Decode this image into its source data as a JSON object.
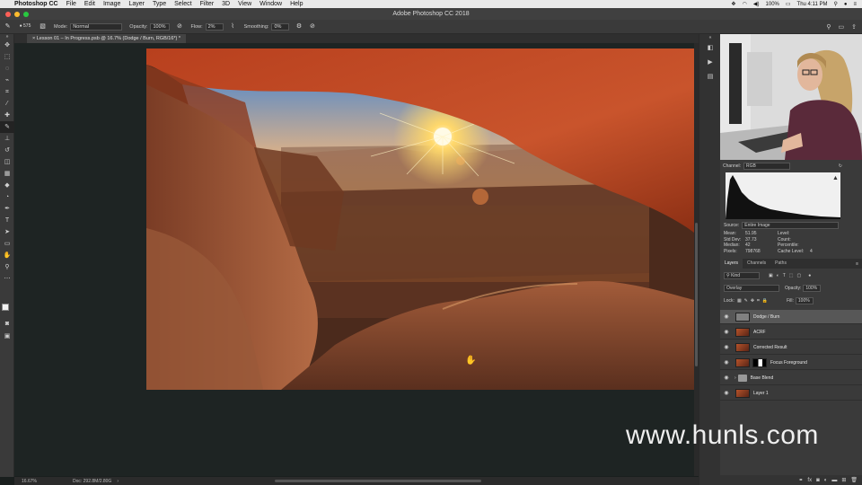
{
  "menubar": {
    "app": "Photoshop CC",
    "items": [
      "File",
      "Edit",
      "Image",
      "Layer",
      "Type",
      "Select",
      "Filter",
      "3D",
      "View",
      "Window",
      "Help"
    ],
    "battery": "100%",
    "clock": "Thu 4:11 PM"
  },
  "window": {
    "title": "Adobe Photoshop CC 2018"
  },
  "options": {
    "brush_size": "575",
    "mode_label": "Mode:",
    "mode_value": "Normal",
    "opacity_label": "Opacity:",
    "opacity_value": "100%",
    "flow_label": "Flow:",
    "flow_value": "2%",
    "smoothing_label": "Smoothing:",
    "smoothing_value": "0%"
  },
  "document": {
    "tab_title": "Lesson 01 – In Progress.psb @ 16.7% (Dodge / Burn, RGB/16*) *"
  },
  "status": {
    "zoom": "16.67%",
    "doc": "Doc: 292.8M/2.80G"
  },
  "histogram": {
    "channel_label": "Channel:",
    "channel_value": "RGB",
    "source_label": "Source:",
    "source_value": "Entire Image",
    "stats": [
      {
        "k": "Mean:",
        "v": "51.95",
        "k2": "Level:",
        "v2": ""
      },
      {
        "k": "Std Dev:",
        "v": "37.73",
        "k2": "Count:",
        "v2": ""
      },
      {
        "k": "Median:",
        "v": "42",
        "k2": "Percentile:",
        "v2": ""
      },
      {
        "k": "Pixels:",
        "v": "798768",
        "k2": "Cache Level:",
        "v2": "4"
      }
    ]
  },
  "layers_panel": {
    "tabs": [
      "Layers",
      "Channels",
      "Paths"
    ],
    "kind": "Kind",
    "blend": "Overlay",
    "opacity_label": "Opacity:",
    "opacity_value": "100%",
    "lock_label": "Lock:",
    "fill_label": "Fill:",
    "fill_value": "100%",
    "layers": [
      {
        "name": "Dodge / Burn",
        "selected": true
      },
      {
        "name": "ACRF"
      },
      {
        "name": "Corrected Result"
      },
      {
        "name": "Focus Foreground"
      },
      {
        "name": "Base Blend"
      },
      {
        "name": "Layer 1"
      }
    ]
  },
  "watermark": "www.hunls.com",
  "colors": {
    "menubar": "#e9e9e9",
    "panel": "#3a3a3a",
    "canvas": "#1e2423",
    "sun": "#ffd86b",
    "rock": "#b6522a"
  }
}
